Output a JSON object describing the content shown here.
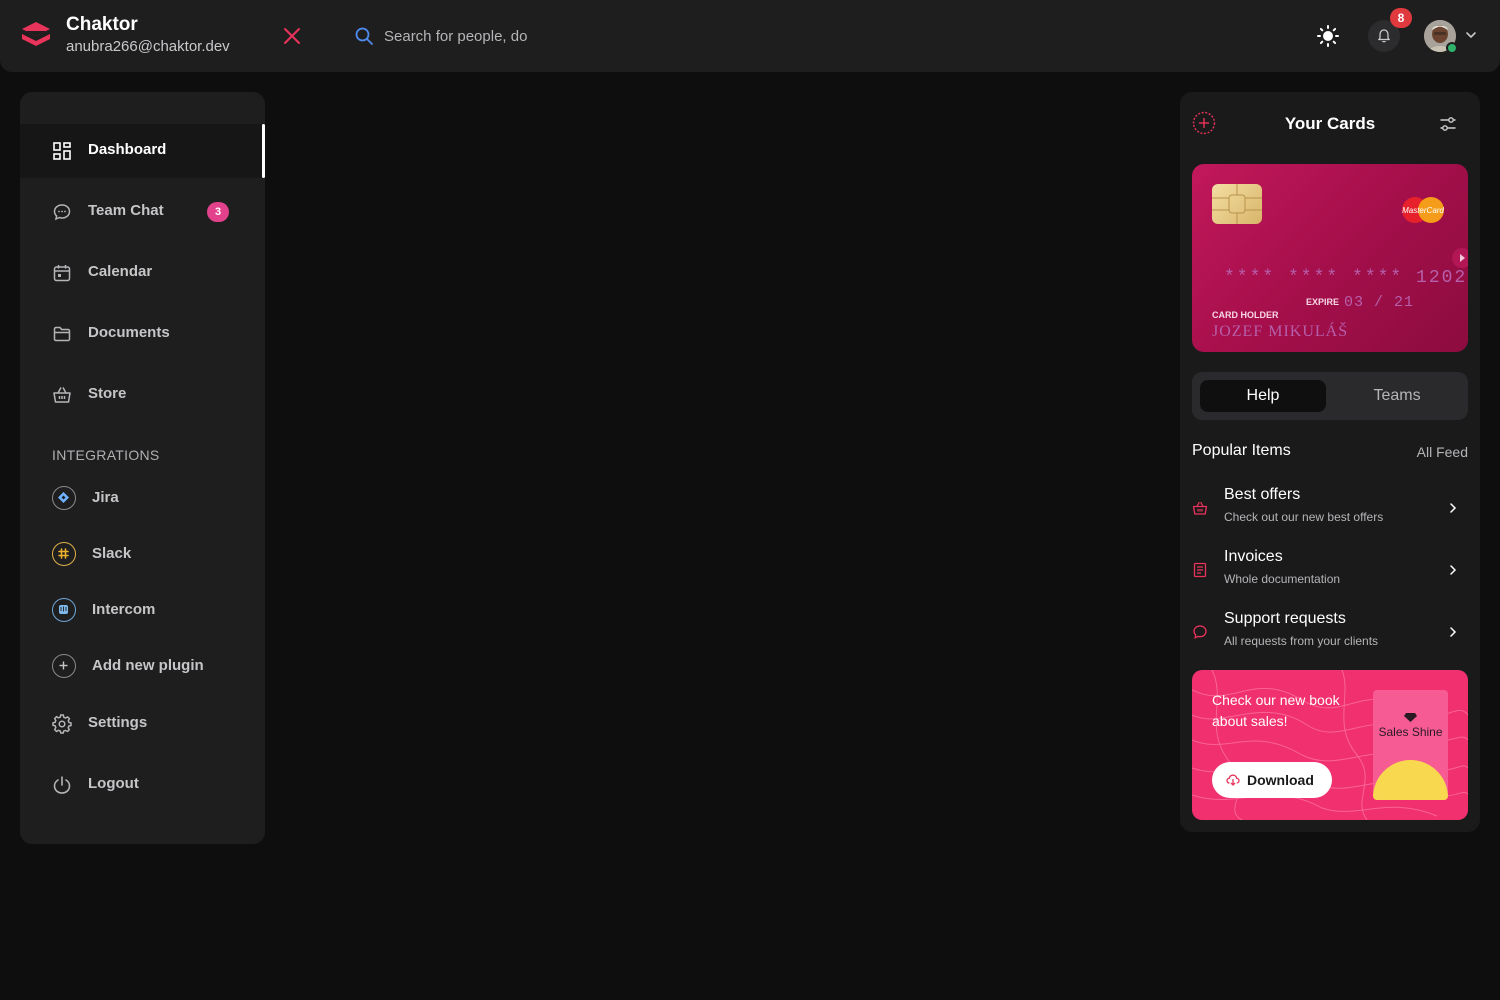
{
  "app": {
    "name": "Chaktor",
    "email": "anubra266@chaktor.dev"
  },
  "search": {
    "placeholder": "Search for people, do"
  },
  "notifications": {
    "count": "8"
  },
  "sidebar": {
    "items": [
      {
        "label": "Dashboard",
        "icon": "dashboard-icon",
        "active": true
      },
      {
        "label": "Team Chat",
        "icon": "chat-icon",
        "badge": "3"
      },
      {
        "label": "Calendar",
        "icon": "calendar-icon"
      },
      {
        "label": "Documents",
        "icon": "folder-icon"
      },
      {
        "label": "Store",
        "icon": "basket-icon"
      }
    ],
    "integrations_title": "INTEGRATIONS",
    "integrations": [
      {
        "label": "Jira",
        "icon": "jira-icon",
        "color": "#2684ff"
      },
      {
        "label": "Slack",
        "icon": "slack-icon",
        "color": "#ecb22e"
      },
      {
        "label": "Intercom",
        "icon": "intercom-icon",
        "color": "#1f8ded"
      },
      {
        "label": "Add new plugin",
        "icon": "plus-icon"
      }
    ],
    "settings_label": "Settings",
    "logout_label": "Logout"
  },
  "cards_panel": {
    "title": "Your Cards",
    "card": {
      "number": "**** **** **** 1202",
      "expire_label": "EXPIRE",
      "expire_value": "03 / 21",
      "holder_label": "CARD HOLDER",
      "holder_name": "JOZEF MIKULÁŠ",
      "brand_text": "MasterCard"
    },
    "tabs": [
      {
        "label": "Help",
        "active": true
      },
      {
        "label": "Teams",
        "active": false
      }
    ],
    "popular_title": "Popular Items",
    "all_feed": "All Feed",
    "popular_items": [
      {
        "title": "Best offers",
        "subtitle": "Check out our new best offers",
        "icon": "basket-icon"
      },
      {
        "title": "Invoices",
        "subtitle": "Whole documentation",
        "icon": "document-icon"
      },
      {
        "title": "Support requests",
        "subtitle": "All requests from your clients",
        "icon": "chat-icon"
      }
    ],
    "promo": {
      "text": "Check our new book about sales!",
      "button_label": "Download",
      "book_title": "Sales Shine"
    }
  },
  "colors": {
    "accent": "#e2418b",
    "background": "#0e0e0e",
    "panel": "#1e1e1f",
    "promo": "#f0306f",
    "card": "#c2185b"
  }
}
